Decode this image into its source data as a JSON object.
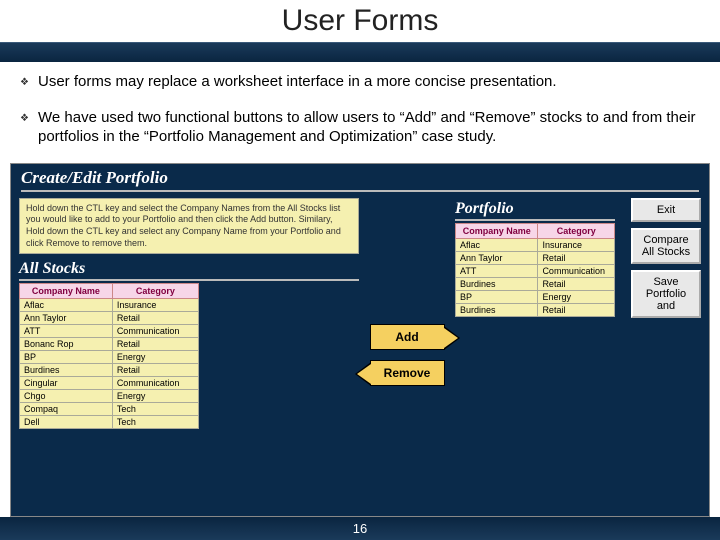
{
  "slide": {
    "title": "User Forms",
    "bullets": [
      "User forms may replace a worksheet interface in a more concise presentation.",
      "We have used two functional buttons to allow users to “Add” and “Remove” stocks to and from their portfolios in the “Portfolio Management and Optimization” case study."
    ],
    "page_number": "16"
  },
  "form": {
    "title": "Create/Edit Portfolio",
    "instructions": "Hold down the CTL key and select the Company Names from the All Stocks list you would like to add to your Portfolio and then click the Add button. Similary, Hold down the CTL key and select any Company Name from your Portfolio and click Remove to remove them.",
    "all_stocks_label": "All Stocks",
    "portfolio_label": "Portfolio",
    "headers": {
      "company": "Company Name",
      "category": "Category"
    },
    "all_stocks": [
      {
        "name": "Aflac",
        "cat": "Insurance"
      },
      {
        "name": "Ann Taylor",
        "cat": "Retail"
      },
      {
        "name": "ATT",
        "cat": "Communication"
      },
      {
        "name": "Bonanc Rop",
        "cat": "Retail"
      },
      {
        "name": "BP",
        "cat": "Energy"
      },
      {
        "name": "Burdines",
        "cat": "Retail"
      },
      {
        "name": "Cingular",
        "cat": "Communication"
      },
      {
        "name": "Chgo",
        "cat": "Energy"
      },
      {
        "name": "Compaq",
        "cat": "Tech"
      },
      {
        "name": "Dell",
        "cat": "Tech"
      }
    ],
    "portfolio": [
      {
        "name": "Aflac",
        "cat": "Insurance"
      },
      {
        "name": "Ann Taylor",
        "cat": "Retail"
      },
      {
        "name": "ATT",
        "cat": "Communication"
      },
      {
        "name": "Burdines",
        "cat": "Retail"
      },
      {
        "name": "BP",
        "cat": "Energy"
      },
      {
        "name": "Burdines",
        "cat": "Retail"
      }
    ],
    "add_label": "Add",
    "remove_label": "Remove",
    "buttons": {
      "exit": "Exit",
      "compare": "Compare All Stocks",
      "save": "Save Portfolio and"
    }
  }
}
